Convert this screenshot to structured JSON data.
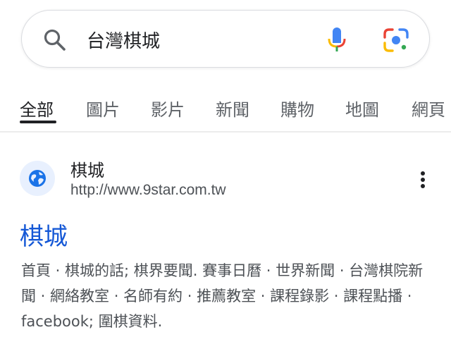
{
  "search": {
    "query": "台灣棋城",
    "icons": {
      "search": "search-icon",
      "voice": "microphone-icon",
      "lens": "google-lens-icon"
    }
  },
  "tabs": [
    {
      "label": "全部",
      "active": true
    },
    {
      "label": "圖片",
      "active": false
    },
    {
      "label": "影片",
      "active": false
    },
    {
      "label": "新聞",
      "active": false
    },
    {
      "label": "購物",
      "active": false
    },
    {
      "label": "地圖",
      "active": false
    },
    {
      "label": "網頁",
      "active": false
    }
  ],
  "result": {
    "site_name": "棋城",
    "url": "http://www.9star.com.tw",
    "title": "棋城",
    "snippet": "首頁 · 棋城的話; 棋界要聞. 賽事日曆 · 世界新聞 · 台灣棋院新聞 · 網絡教室 · 名師有約 · 推薦教室 · 課程錄影 · 課程點播 · facebook; 圍棋資料.",
    "favicon": "globe-icon",
    "menu_icon": "more-vert-icon"
  },
  "colors": {
    "link": "#1558d6",
    "tab_active": "#202124",
    "tab_inactive": "#5f6368",
    "favicon_bg": "#e8f0fe",
    "favicon_fg": "#1a73e8"
  }
}
